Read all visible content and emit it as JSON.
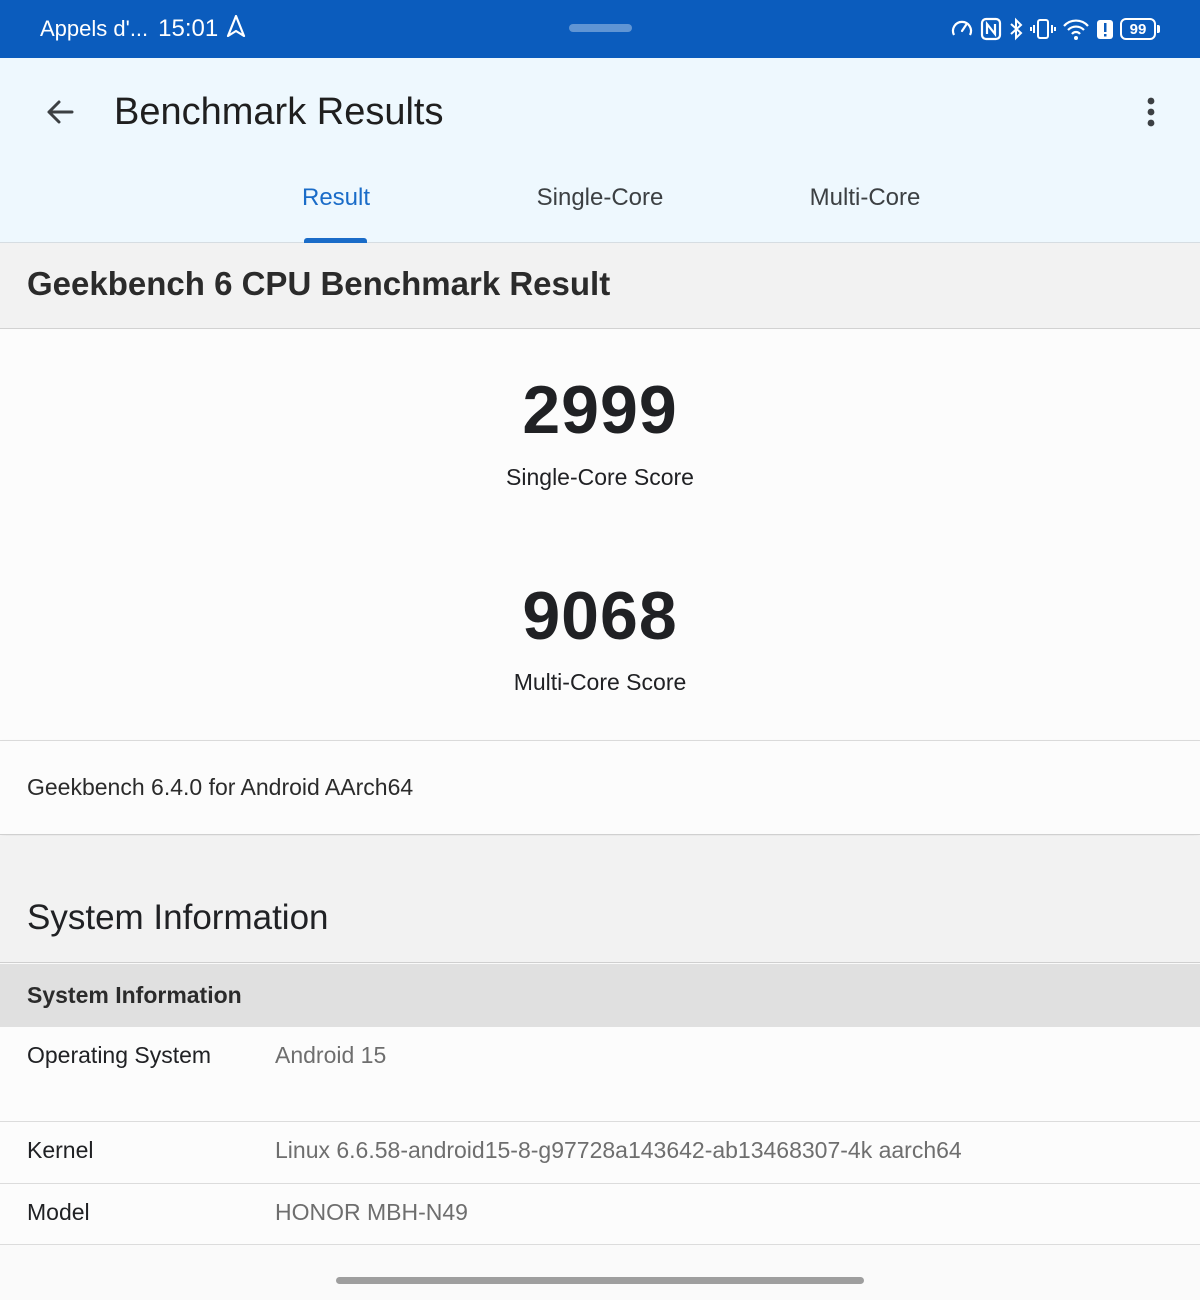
{
  "status_bar": {
    "carrier": "Appels d'...",
    "time": "15:01",
    "battery": "99",
    "icons": [
      "navigation-arrow-icon",
      "speedometer-icon",
      "nfc-icon",
      "bluetooth-icon",
      "vibrate-icon",
      "wifi-icon",
      "alert-icon",
      "battery-icon"
    ],
    "background": "#0b5cbd"
  },
  "app_bar": {
    "title": "Benchmark Results",
    "tabs": [
      {
        "label": "Result",
        "active": true
      },
      {
        "label": "Single-Core",
        "active": false
      },
      {
        "label": "Multi-Core",
        "active": false
      }
    ],
    "accent": "#1a6cc8"
  },
  "result": {
    "heading": "Geekbench 6 CPU Benchmark Result",
    "single_core_score": "2999",
    "single_core_label": "Single-Core Score",
    "multi_core_score": "9068",
    "multi_core_label": "Multi-Core Score",
    "version": "Geekbench 6.4.0 for Android AArch64"
  },
  "system_information": {
    "heading": "System Information",
    "subheading": "System Information",
    "rows": [
      {
        "key": "Operating System",
        "value": "Android 15"
      },
      {
        "key": "Kernel",
        "value": "Linux 6.6.58-android15-8-g97728a143642-ab13468307-4k aarch64"
      },
      {
        "key": "Model",
        "value": "HONOR MBH-N49"
      }
    ]
  }
}
